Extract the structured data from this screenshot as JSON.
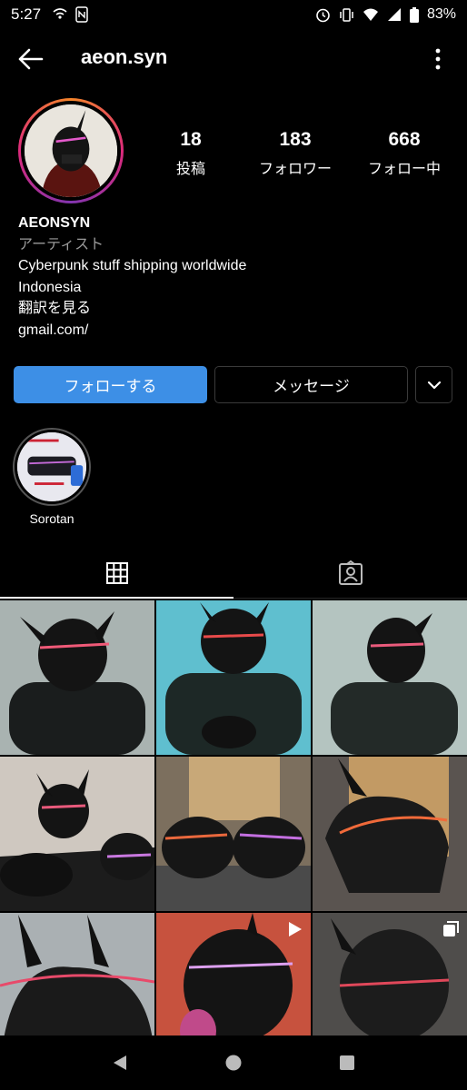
{
  "status": {
    "time": "5:27",
    "battery": "83%"
  },
  "header": {
    "username": "aeon.syn"
  },
  "stats": [
    {
      "value": "18",
      "label": "投稿"
    },
    {
      "value": "183",
      "label": "フォロワー"
    },
    {
      "value": "668",
      "label": "フォロー中"
    }
  ],
  "bio": {
    "name": "AEONSYN",
    "category": "アーティスト",
    "line1": "Cyberpunk stuff shipping worldwide",
    "line2": "Indonesia",
    "translate": "翻訳を見る",
    "link": "gmail.com/"
  },
  "actions": {
    "follow": "フォローする",
    "message": "メッセージ"
  },
  "highlights": [
    {
      "label": "Sorotan"
    }
  ],
  "colors": {
    "accent": "#3d8fe6",
    "background": "#000000"
  },
  "icons": {
    "tab_grid": "grid-icon",
    "tab_tagged": "tagged-person-icon"
  },
  "posts": [
    {
      "type": "photo"
    },
    {
      "type": "photo"
    },
    {
      "type": "photo"
    },
    {
      "type": "photo"
    },
    {
      "type": "photo"
    },
    {
      "type": "photo"
    },
    {
      "type": "photo"
    },
    {
      "type": "video"
    },
    {
      "type": "carousel"
    }
  ]
}
